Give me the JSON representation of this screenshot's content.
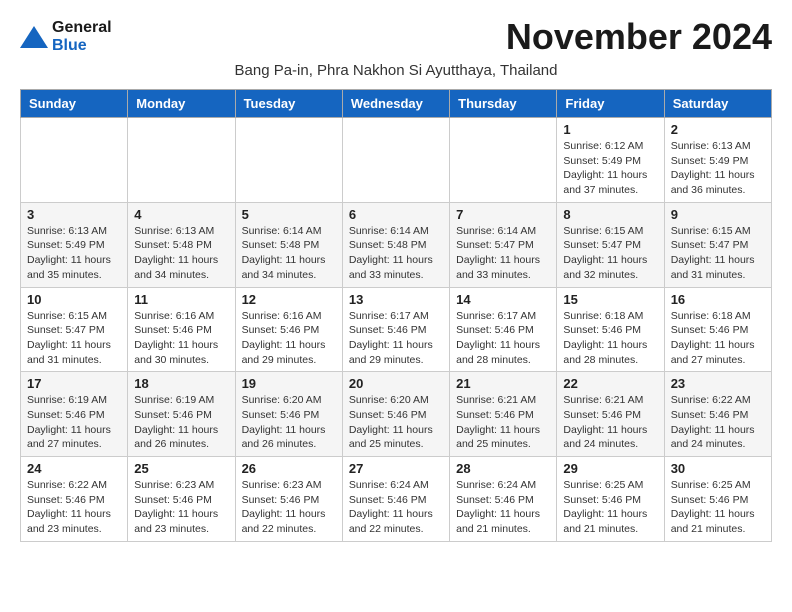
{
  "logo": {
    "line1": "General",
    "line2": "Blue"
  },
  "title": "November 2024",
  "subtitle": "Bang Pa-in, Phra Nakhon Si Ayutthaya, Thailand",
  "days_of_week": [
    "Sunday",
    "Monday",
    "Tuesday",
    "Wednesday",
    "Thursday",
    "Friday",
    "Saturday"
  ],
  "weeks": [
    [
      {
        "day": "",
        "info": ""
      },
      {
        "day": "",
        "info": ""
      },
      {
        "day": "",
        "info": ""
      },
      {
        "day": "",
        "info": ""
      },
      {
        "day": "",
        "info": ""
      },
      {
        "day": "1",
        "info": "Sunrise: 6:12 AM\nSunset: 5:49 PM\nDaylight: 11 hours and 37 minutes."
      },
      {
        "day": "2",
        "info": "Sunrise: 6:13 AM\nSunset: 5:49 PM\nDaylight: 11 hours and 36 minutes."
      }
    ],
    [
      {
        "day": "3",
        "info": "Sunrise: 6:13 AM\nSunset: 5:49 PM\nDaylight: 11 hours and 35 minutes."
      },
      {
        "day": "4",
        "info": "Sunrise: 6:13 AM\nSunset: 5:48 PM\nDaylight: 11 hours and 34 minutes."
      },
      {
        "day": "5",
        "info": "Sunrise: 6:14 AM\nSunset: 5:48 PM\nDaylight: 11 hours and 34 minutes."
      },
      {
        "day": "6",
        "info": "Sunrise: 6:14 AM\nSunset: 5:48 PM\nDaylight: 11 hours and 33 minutes."
      },
      {
        "day": "7",
        "info": "Sunrise: 6:14 AM\nSunset: 5:47 PM\nDaylight: 11 hours and 33 minutes."
      },
      {
        "day": "8",
        "info": "Sunrise: 6:15 AM\nSunset: 5:47 PM\nDaylight: 11 hours and 32 minutes."
      },
      {
        "day": "9",
        "info": "Sunrise: 6:15 AM\nSunset: 5:47 PM\nDaylight: 11 hours and 31 minutes."
      }
    ],
    [
      {
        "day": "10",
        "info": "Sunrise: 6:15 AM\nSunset: 5:47 PM\nDaylight: 11 hours and 31 minutes."
      },
      {
        "day": "11",
        "info": "Sunrise: 6:16 AM\nSunset: 5:46 PM\nDaylight: 11 hours and 30 minutes."
      },
      {
        "day": "12",
        "info": "Sunrise: 6:16 AM\nSunset: 5:46 PM\nDaylight: 11 hours and 29 minutes."
      },
      {
        "day": "13",
        "info": "Sunrise: 6:17 AM\nSunset: 5:46 PM\nDaylight: 11 hours and 29 minutes."
      },
      {
        "day": "14",
        "info": "Sunrise: 6:17 AM\nSunset: 5:46 PM\nDaylight: 11 hours and 28 minutes."
      },
      {
        "day": "15",
        "info": "Sunrise: 6:18 AM\nSunset: 5:46 PM\nDaylight: 11 hours and 28 minutes."
      },
      {
        "day": "16",
        "info": "Sunrise: 6:18 AM\nSunset: 5:46 PM\nDaylight: 11 hours and 27 minutes."
      }
    ],
    [
      {
        "day": "17",
        "info": "Sunrise: 6:19 AM\nSunset: 5:46 PM\nDaylight: 11 hours and 27 minutes."
      },
      {
        "day": "18",
        "info": "Sunrise: 6:19 AM\nSunset: 5:46 PM\nDaylight: 11 hours and 26 minutes."
      },
      {
        "day": "19",
        "info": "Sunrise: 6:20 AM\nSunset: 5:46 PM\nDaylight: 11 hours and 26 minutes."
      },
      {
        "day": "20",
        "info": "Sunrise: 6:20 AM\nSunset: 5:46 PM\nDaylight: 11 hours and 25 minutes."
      },
      {
        "day": "21",
        "info": "Sunrise: 6:21 AM\nSunset: 5:46 PM\nDaylight: 11 hours and 25 minutes."
      },
      {
        "day": "22",
        "info": "Sunrise: 6:21 AM\nSunset: 5:46 PM\nDaylight: 11 hours and 24 minutes."
      },
      {
        "day": "23",
        "info": "Sunrise: 6:22 AM\nSunset: 5:46 PM\nDaylight: 11 hours and 24 minutes."
      }
    ],
    [
      {
        "day": "24",
        "info": "Sunrise: 6:22 AM\nSunset: 5:46 PM\nDaylight: 11 hours and 23 minutes."
      },
      {
        "day": "25",
        "info": "Sunrise: 6:23 AM\nSunset: 5:46 PM\nDaylight: 11 hours and 23 minutes."
      },
      {
        "day": "26",
        "info": "Sunrise: 6:23 AM\nSunset: 5:46 PM\nDaylight: 11 hours and 22 minutes."
      },
      {
        "day": "27",
        "info": "Sunrise: 6:24 AM\nSunset: 5:46 PM\nDaylight: 11 hours and 22 minutes."
      },
      {
        "day": "28",
        "info": "Sunrise: 6:24 AM\nSunset: 5:46 PM\nDaylight: 11 hours and 21 minutes."
      },
      {
        "day": "29",
        "info": "Sunrise: 6:25 AM\nSunset: 5:46 PM\nDaylight: 11 hours and 21 minutes."
      },
      {
        "day": "30",
        "info": "Sunrise: 6:25 AM\nSunset: 5:46 PM\nDaylight: 11 hours and 21 minutes."
      }
    ]
  ]
}
